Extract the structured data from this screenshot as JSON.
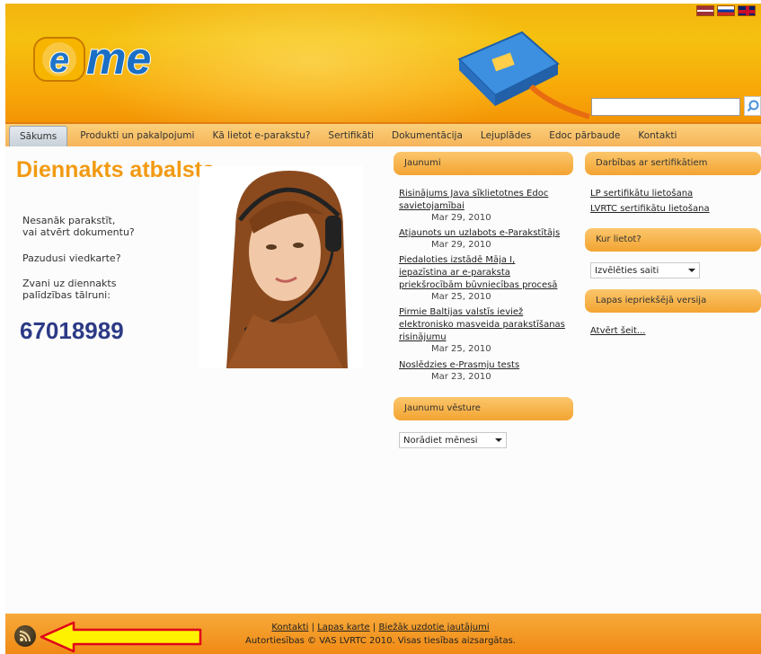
{
  "brand": {
    "logo_letter": "e",
    "logo_text": "me"
  },
  "search": {
    "value": "",
    "placeholder": ""
  },
  "flags": [
    "lv",
    "ru",
    "en"
  ],
  "nav": {
    "items": [
      "Sākums",
      "Produkti un pakalpojumi",
      "Kā lietot e-parakstu?",
      "Sertifikāti",
      "Dokumentācija",
      "Lejuplādes",
      "Edoc pārbaude",
      "Kontakti"
    ],
    "active": "Sākums"
  },
  "support": {
    "title": "Diennakts atbalsts",
    "line1": "Nesanāk parakstīt,",
    "line2": "vai atvērt dokumentu?",
    "line3": "Pazudusi viedkarte?",
    "line4": "Zvani uz diennakts",
    "line5": "palīdzības tālruni:",
    "phone": "67018989"
  },
  "news": {
    "title": "Jaunumi",
    "items": [
      {
        "lines": [
          "Risinājums Java sīklietotnes Edoc",
          "savietojamībai"
        ],
        "date": "Mar 29, 2010"
      },
      {
        "lines": [
          "Atjaunots un uzlabots e-Parakstītājs"
        ],
        "date": "Mar 29, 2010"
      },
      {
        "lines": [
          "Piedaloties izstādē Māja I,",
          "iepazīstina ar e-paraksta",
          "priekšrocībām būvniecības procesā"
        ],
        "date": "Mar 25, 2010"
      },
      {
        "lines": [
          "Pirmie Baltijas valstīs ieviež",
          "elektronisko masveida parakstīšanas",
          "risinājumu"
        ],
        "date": "Mar 25, 2010"
      },
      {
        "lines": [
          "Noslēdzies e-Prasmju tests"
        ],
        "date": "Mar 23, 2010"
      }
    ]
  },
  "news_history": {
    "title": "Jaunumu vēsture",
    "select_value": "Norādiet mēnesi"
  },
  "certificates": {
    "title": "Darbības ar sertifikātiem",
    "links": [
      "LP sertifikātu lietošana",
      "LVRTC sertifikātu lietošana"
    ]
  },
  "where_use": {
    "title": "Kur lietot?",
    "select_value": "Izvēlēties saiti"
  },
  "previous_version": {
    "title": "Lapas iepriekšējā versija",
    "link": "Atvērt šeit..."
  },
  "footer": {
    "links": [
      "Kontakti",
      "Lapas karte",
      "Biežāk uzdotie jautājumi"
    ],
    "separator": "|",
    "copyright": "Autortiesības © VAS LVRTC 2010. Visas tiesības aizsargātas."
  },
  "colors": {
    "header_orange": "#f5b20c",
    "title_orange": "#f29a12",
    "phone_blue": "#2c3a86",
    "annotation_arrow": "#fff200",
    "annotation_arrow_border": "#e0001a"
  }
}
